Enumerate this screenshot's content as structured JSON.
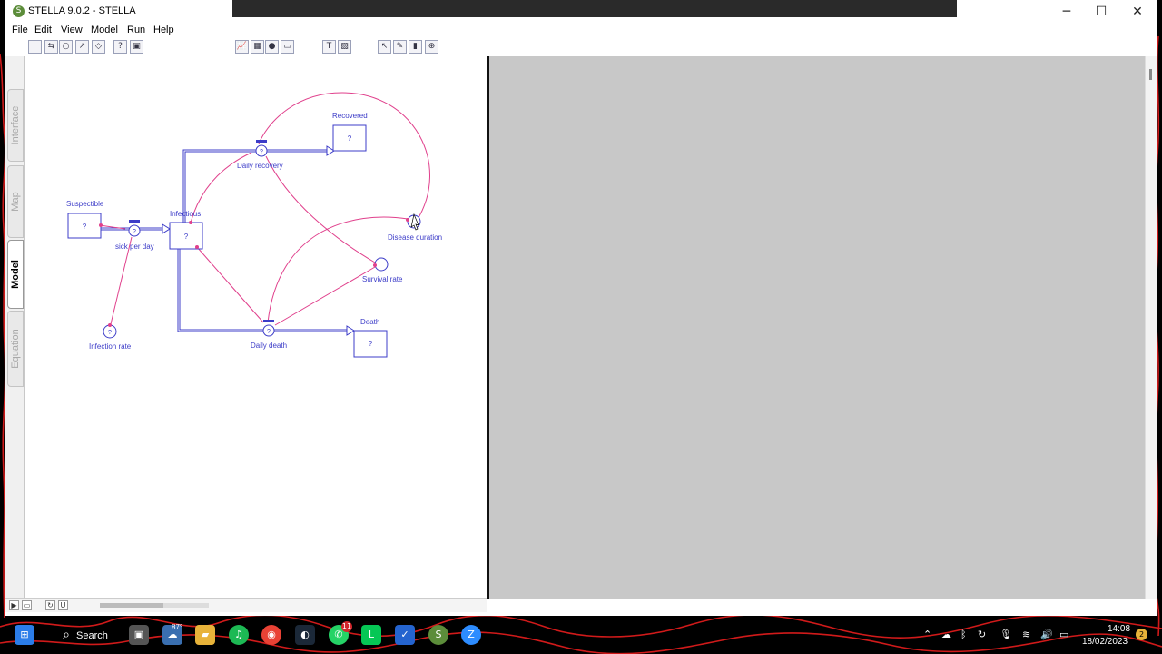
{
  "window": {
    "title": "STELLA 9.0.2 - STELLA",
    "app_icon_glyph": "S",
    "controls": {
      "minimize": "─",
      "maximize": "☐",
      "close": "✕"
    }
  },
  "menu": [
    "File",
    "Edit",
    "View",
    "Model",
    "Run",
    "Help"
  ],
  "toolbar_icons": [
    {
      "name": "stock-tool-icon",
      "glyph": ""
    },
    {
      "name": "flow-tool-icon",
      "glyph": "⇆"
    },
    {
      "name": "converter-tool-icon",
      "glyph": "○"
    },
    {
      "name": "connector-tool-icon",
      "glyph": "↗"
    },
    {
      "name": "decision-tool-icon",
      "glyph": "◇"
    },
    {
      "name": "help-tool-icon",
      "glyph": "?"
    },
    {
      "name": "record-tool-icon",
      "glyph": "▣"
    },
    {
      "name": "graph-tool-icon",
      "glyph": "📈"
    },
    {
      "name": "table-tool-icon",
      "glyph": "▦"
    },
    {
      "name": "knob-tool-icon",
      "glyph": "●"
    },
    {
      "name": "numeric-display-tool-icon",
      "glyph": "▭"
    },
    {
      "name": "text-tool-icon",
      "glyph": "T"
    },
    {
      "name": "picture-tool-icon",
      "glyph": "▨"
    },
    {
      "name": "pointer-tool-icon",
      "glyph": "↖"
    },
    {
      "name": "paintbrush-tool-icon",
      "glyph": "✎"
    },
    {
      "name": "dynamite-tool-icon",
      "glyph": "▮"
    },
    {
      "name": "ghost-tool-icon",
      "glyph": "⊕"
    }
  ],
  "side_tabs": [
    {
      "label": "Interface",
      "active": false
    },
    {
      "label": "Map",
      "active": false
    },
    {
      "label": "Model",
      "active": true
    },
    {
      "label": "Equation",
      "active": false
    }
  ],
  "diagram": {
    "unknown_value": "?",
    "stocks": {
      "susceptible": "Suspectible",
      "infectious": "Infectious",
      "recovered": "Recovered",
      "death": "Death"
    },
    "flows": {
      "sick_per_day": "sick per day",
      "daily_recovery": "Daily recovery",
      "daily_death": "Daily death"
    },
    "converters": {
      "infection_rate": "Infection rate",
      "disease_duration": "Disease duration",
      "survival_rate": "Survival rate"
    }
  },
  "colors": {
    "model_blue": "#3c3cc8",
    "connector_pink": "#e0408c",
    "right_panel_gray": "#c8c8c8",
    "wallpaper_lines": "#d11a1a"
  },
  "taskbar": {
    "search_label": "Search",
    "weather_temp": "87°",
    "whatsapp_badge": "11",
    "clock_time": "14:08",
    "clock_date": "18/02/2023",
    "notification_count": "2"
  }
}
